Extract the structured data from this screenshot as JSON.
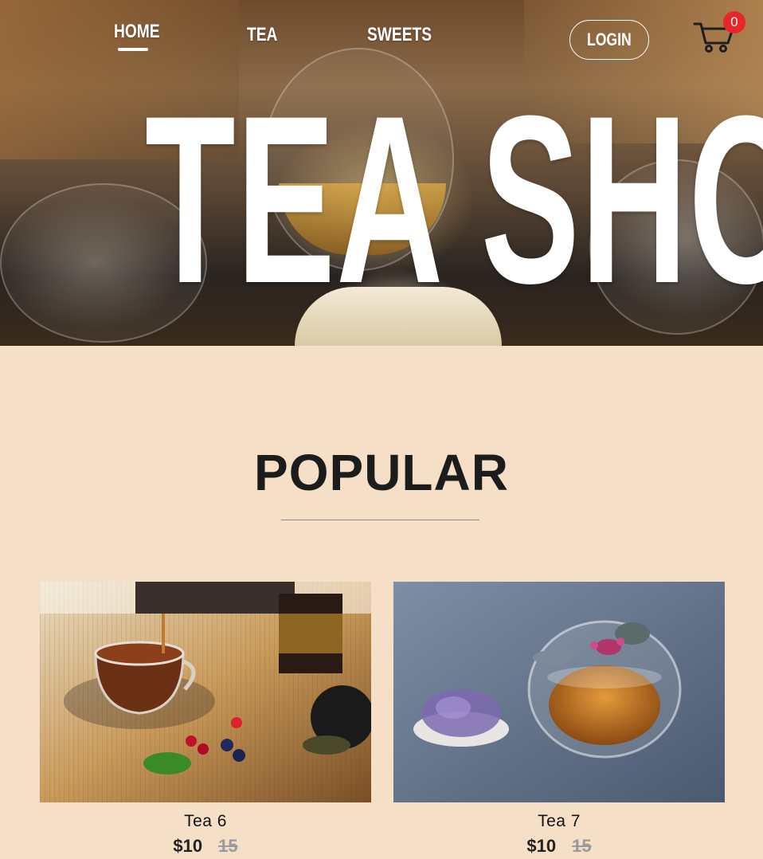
{
  "nav": {
    "links": [
      {
        "label": "HOME",
        "active": true
      },
      {
        "label": "TEA",
        "active": false
      },
      {
        "label": "SWEETS",
        "active": false
      }
    ],
    "login_label": "LOGIN",
    "cart_count": "0",
    "cart_icon": "cart-icon"
  },
  "hero": {
    "title": "TEA SHOP"
  },
  "popular": {
    "title": "POPULAR",
    "products": [
      {
        "name": "Tea 6",
        "price": "$10",
        "old_price": "15"
      },
      {
        "name": "Tea 7",
        "price": "$10",
        "old_price": "15"
      }
    ]
  },
  "colors": {
    "page_bg": "#f6dfc7",
    "badge": "#e8262a",
    "text_dark": "#1c1c1c",
    "strike": "#9a9a9a"
  }
}
